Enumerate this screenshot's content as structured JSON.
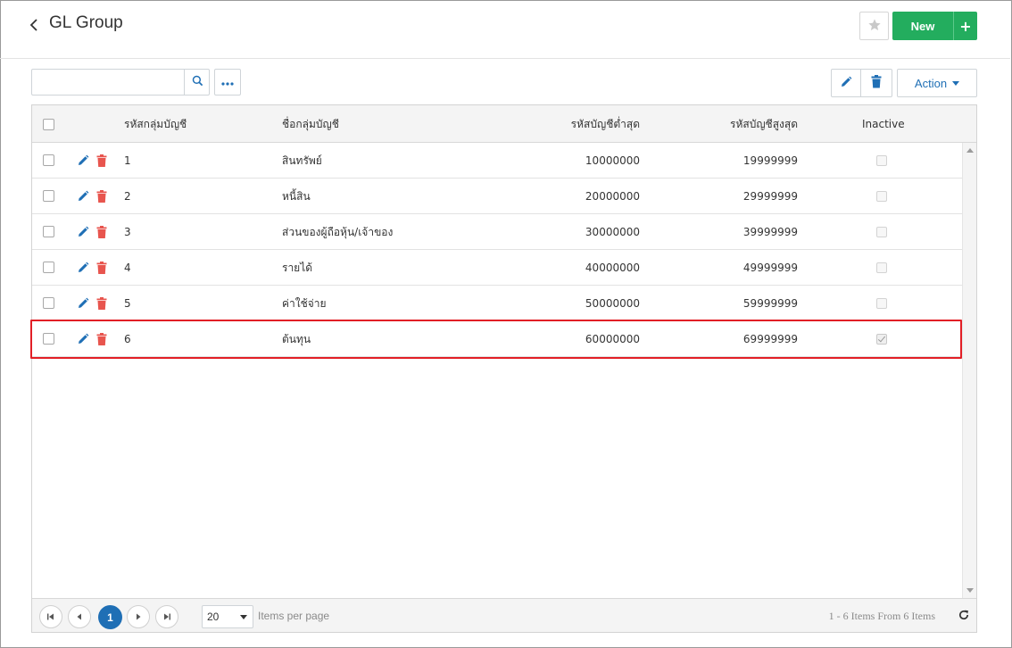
{
  "header": {
    "title": "GL Group",
    "new_label": "New",
    "new_plus": "+"
  },
  "toolbar": {
    "search_value": "",
    "search_placeholder": "",
    "more_label": "•••",
    "action_label": "Action"
  },
  "table": {
    "columns": {
      "code": "รหัสกลุ่มบัญชี",
      "name": "ชื่อกลุ่มบัญชี",
      "min": "รหัสบัญชีต่ำสุด",
      "max": "รหัสบัญชีสูงสุด",
      "inactive": "Inactive"
    },
    "rows": [
      {
        "code": "1",
        "name": "สินทรัพย์",
        "min": "10000000",
        "max": "19999999",
        "inactive": false
      },
      {
        "code": "2",
        "name": "หนี้สิน",
        "min": "20000000",
        "max": "29999999",
        "inactive": false
      },
      {
        "code": "3",
        "name": "ส่วนของผู้ถือหุ้น/เจ้าของ",
        "min": "30000000",
        "max": "39999999",
        "inactive": false
      },
      {
        "code": "4",
        "name": "รายได้",
        "min": "40000000",
        "max": "49999999",
        "inactive": false
      },
      {
        "code": "5",
        "name": "ค่าใช้จ่าย",
        "min": "50000000",
        "max": "59999999",
        "inactive": false
      },
      {
        "code": "6",
        "name": "ต้นทุน",
        "min": "60000000",
        "max": "69999999",
        "inactive": true
      }
    ],
    "highlighted_row": 6
  },
  "pager": {
    "current_page": "1",
    "page_size": "20",
    "items_per_page_label": "Items per page",
    "info": "1 - 6 Items From 6 Items"
  },
  "colors": {
    "primary_blue": "#1f6fb5",
    "new_green": "#23ad5e",
    "delete_red": "#e8554e",
    "highlight_red": "#e21f26"
  }
}
